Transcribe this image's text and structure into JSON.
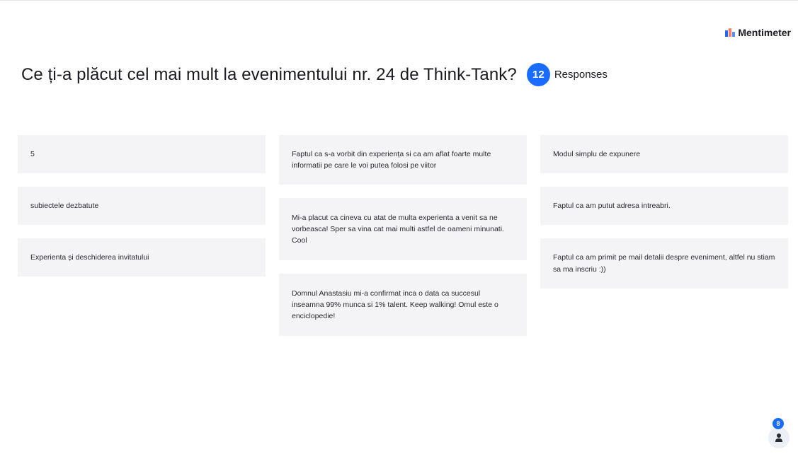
{
  "brand": {
    "name": "Mentimeter",
    "colors": {
      "bar1": "#196cff",
      "bar2": "#ff7d6a",
      "bar3": "#5690f5"
    }
  },
  "question": {
    "title": "Ce ți-a plăcut cel mai mult la evenimentului nr. 24 de Think-Tank?",
    "response_count": "12",
    "response_label": "Responses"
  },
  "accent_color": "#196cff",
  "columns": [
    {
      "cards": [
        {
          "text": "5"
        },
        {
          "text": "subiectele dezbatute"
        },
        {
          "text": "Experienta și deschiderea invitatului"
        }
      ]
    },
    {
      "cards": [
        {
          "text": "Faptul ca s-a vorbit din experiența si ca am aflat foarte multe informatii pe care le voi putea folosi pe viitor"
        },
        {
          "text": "Mi-a placut ca cineva cu atat de multa experienta a venit sa ne vorbeasca! Sper sa vina cat mai multi astfel de oameni minunati. Cool"
        },
        {
          "text": "Domnul Anastasiu mi-a confirmat inca o data ca succesul inseamna 99% munca si 1% talent. Keep walking! Omul este o enciclopedie!"
        }
      ]
    },
    {
      "cards": [
        {
          "text": "Modul simplu de expunere"
        },
        {
          "text": "Faptul ca am putut adresa intreabri."
        },
        {
          "text": "Faptul ca am primit pe mail detalii despre eveniment, altfel nu stiam sa ma inscriu :))"
        }
      ]
    }
  ],
  "audience": {
    "icon": "person-icon",
    "count": "8"
  }
}
